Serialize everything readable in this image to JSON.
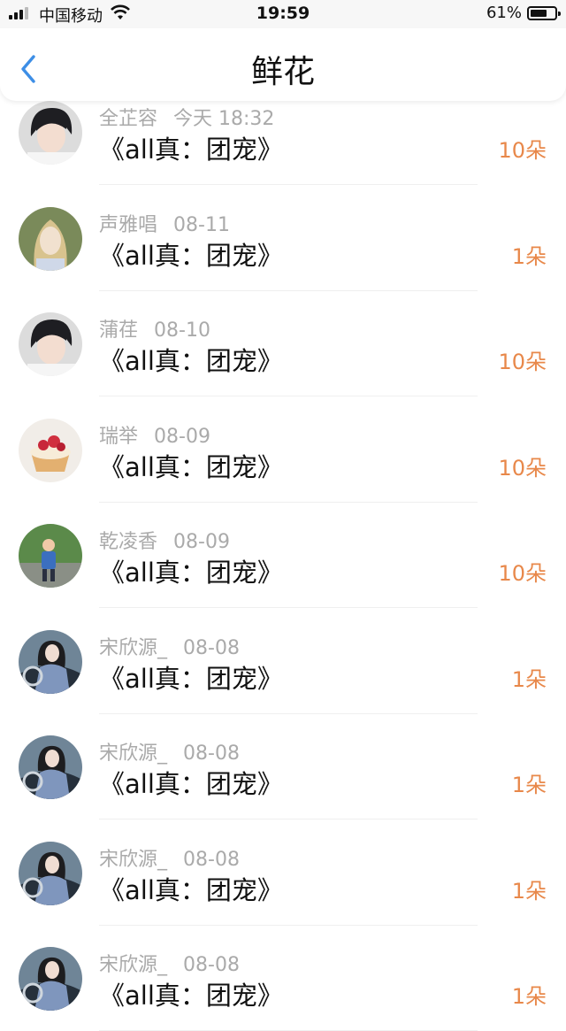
{
  "status_bar": {
    "carrier": "中国移动",
    "time": "19:59",
    "battery": "61%",
    "battery_level": 0.61
  },
  "nav": {
    "title": "鲜花"
  },
  "items": [
    {
      "name": "全芷容",
      "date": "今天 18:32",
      "book": "《all真：团宠》",
      "count": "10朵",
      "avatar": "boy-portrait"
    },
    {
      "name": "声雅唱",
      "date": "08-11",
      "book": "《all真：团宠》",
      "count": "1朵",
      "avatar": "elf-portrait"
    },
    {
      "name": "蒲荏",
      "date": "08-10",
      "book": "《all真：团宠》",
      "count": "10朵",
      "avatar": "boy-portrait"
    },
    {
      "name": "瑞举",
      "date": "08-09",
      "book": "《all真：团宠》",
      "count": "10朵",
      "avatar": "cake"
    },
    {
      "name": "乾凌香",
      "date": "08-09",
      "book": "《all真：团宠》",
      "count": "10朵",
      "avatar": "child-outdoor"
    },
    {
      "name": "宋欣源_",
      "date": "08-08",
      "book": "《all真：团宠》",
      "count": "1朵",
      "avatar": "girl-car"
    },
    {
      "name": "宋欣源_",
      "date": "08-08",
      "book": "《all真：团宠》",
      "count": "1朵",
      "avatar": "girl-car"
    },
    {
      "name": "宋欣源_",
      "date": "08-08",
      "book": "《all真：团宠》",
      "count": "1朵",
      "avatar": "girl-car"
    },
    {
      "name": "宋欣源_",
      "date": "08-08",
      "book": "《all真：团宠》",
      "count": "1朵",
      "avatar": "girl-car"
    }
  ]
}
